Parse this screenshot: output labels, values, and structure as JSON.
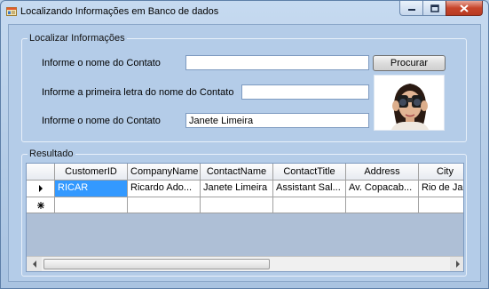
{
  "window": {
    "title": "Localizando Informações em Banco de dados",
    "icon": "app-form-icon"
  },
  "search_group": {
    "legend": "Localizar Informações",
    "contact_name_label": "Informe o nome do Contato",
    "contact_name_value": "",
    "first_letter_label": "Informe a primeira letra do nome do Contato",
    "first_letter_value": "",
    "contact_name2_label": "Informe o nome do Contato",
    "contact_name2_value": "Janete Limeira",
    "search_button": "Procurar",
    "image": "woman-with-binoculars"
  },
  "result_group": {
    "legend": "Resultado",
    "columns": [
      "CustomerID",
      "CompanyName",
      "ContactName",
      "ContactTitle",
      "Address",
      "City"
    ],
    "rows": [
      [
        "RICAR",
        "Ricardo Ado...",
        "Janete Limeira",
        "Assistant Sal...",
        "Av. Copacab...",
        "Rio de Ja"
      ]
    ],
    "current_row_marker": "arrow-right-icon",
    "new_row_marker": "asterisk-icon",
    "colors": {
      "selected_cell": "#3399ff"
    }
  }
}
